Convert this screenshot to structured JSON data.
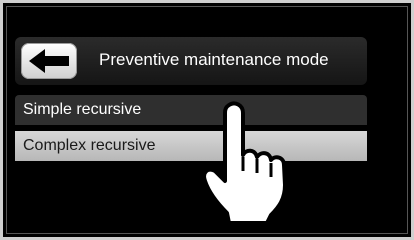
{
  "screen": {
    "title": "Preventive maintenance mode",
    "back_icon": "arrow-left-icon",
    "menu": [
      {
        "label": "Simple recursive",
        "selected": false
      },
      {
        "label": "Complex recursive",
        "selected": true
      }
    ],
    "pointer_icon": "pointing-hand-icon"
  },
  "colors": {
    "screen_bg": "#000000",
    "header_bg": "#1e1e1e",
    "item_bg": "#2f2f2f",
    "item_highlight_bg": "#c8c8c8",
    "text_light": "#ffffff",
    "text_dark": "#1a1a1a"
  }
}
